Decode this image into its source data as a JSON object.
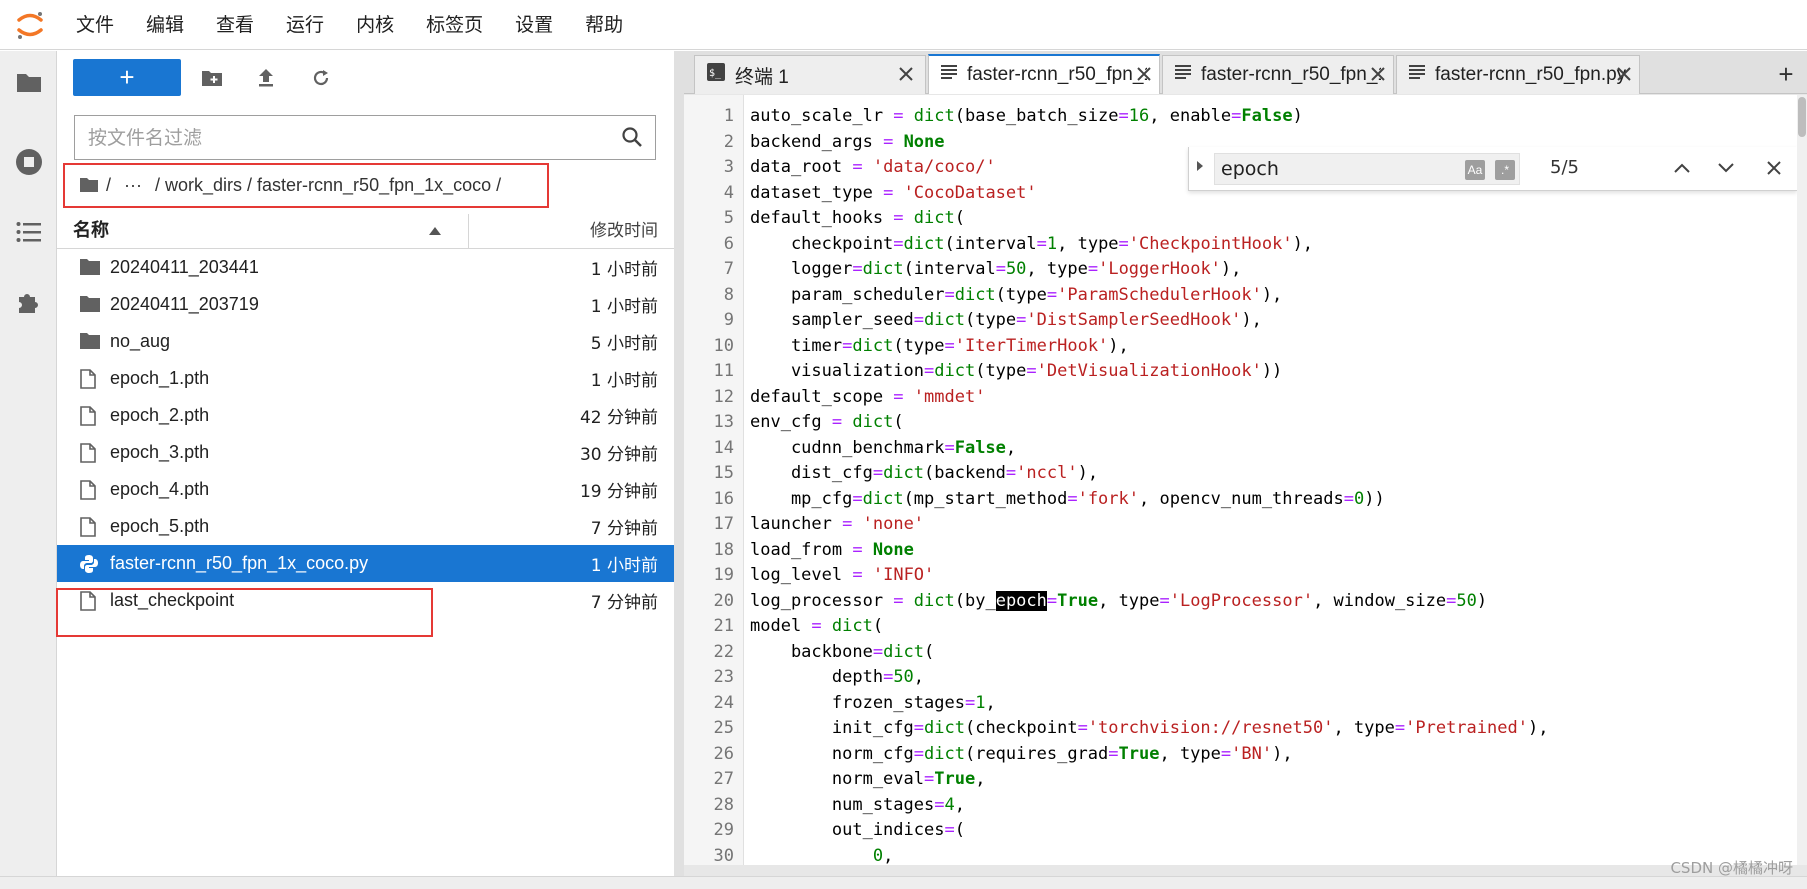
{
  "menu": [
    "文件",
    "编辑",
    "查看",
    "运行",
    "内核",
    "标签页",
    "设置",
    "帮助"
  ],
  "filebrowser": {
    "new_label": "+",
    "filter_placeholder": "按文件名过滤",
    "breadcrumb": [
      "/",
      "···",
      "/ work_dirs / faster-rcnn_r50_fpn_1x_coco /"
    ],
    "col_name": "名称",
    "col_modified": "修改时间",
    "files": [
      {
        "name": "20240411_203441",
        "type": "folder",
        "modified": "1 小时前"
      },
      {
        "name": "20240411_203719",
        "type": "folder",
        "modified": "1 小时前"
      },
      {
        "name": "no_aug",
        "type": "folder",
        "modified": "5 小时前"
      },
      {
        "name": "epoch_1.pth",
        "type": "file",
        "modified": "1 小时前"
      },
      {
        "name": "epoch_2.pth",
        "type": "file",
        "modified": "42 分钟前"
      },
      {
        "name": "epoch_3.pth",
        "type": "file",
        "modified": "30 分钟前"
      },
      {
        "name": "epoch_4.pth",
        "type": "file",
        "modified": "19 分钟前"
      },
      {
        "name": "epoch_5.pth",
        "type": "file",
        "modified": "7 分钟前"
      },
      {
        "name": "faster-rcnn_r50_fpn_1x_coco.py",
        "type": "python",
        "modified": "1 小时前",
        "selected": true
      },
      {
        "name": "last_checkpoint",
        "type": "file",
        "modified": "7 分钟前"
      }
    ]
  },
  "tabs": [
    {
      "label": "终端 1",
      "icon": "terminal-icon"
    },
    {
      "label": "faster-rcnn_r50_fpn_1x",
      "icon": "text-file-icon",
      "active": true
    },
    {
      "label": "faster-rcnn_r50_fpn_1x",
      "icon": "text-file-icon"
    },
    {
      "label": "faster-rcnn_r50_fpn.py",
      "icon": "text-file-icon"
    }
  ],
  "add_tab": "+",
  "find": {
    "query": "epoch",
    "count": "5/5"
  },
  "code_lines": [
    "1",
    "2",
    "3",
    "4",
    "5",
    "6",
    "7",
    "8",
    "9",
    "10",
    "11",
    "12",
    "13",
    "14",
    "15",
    "16",
    "17",
    "18",
    "19",
    "20",
    "21",
    "22",
    "23",
    "24",
    "25",
    "26",
    "27",
    "28",
    "29",
    "30"
  ],
  "watermark": "CSDN @橘橘冲呀",
  "colors": {
    "accent": "#1976d2",
    "highlight_box": "#e53935",
    "string": "#ba2121",
    "number": "#008000",
    "operator": "#aa22ff"
  }
}
